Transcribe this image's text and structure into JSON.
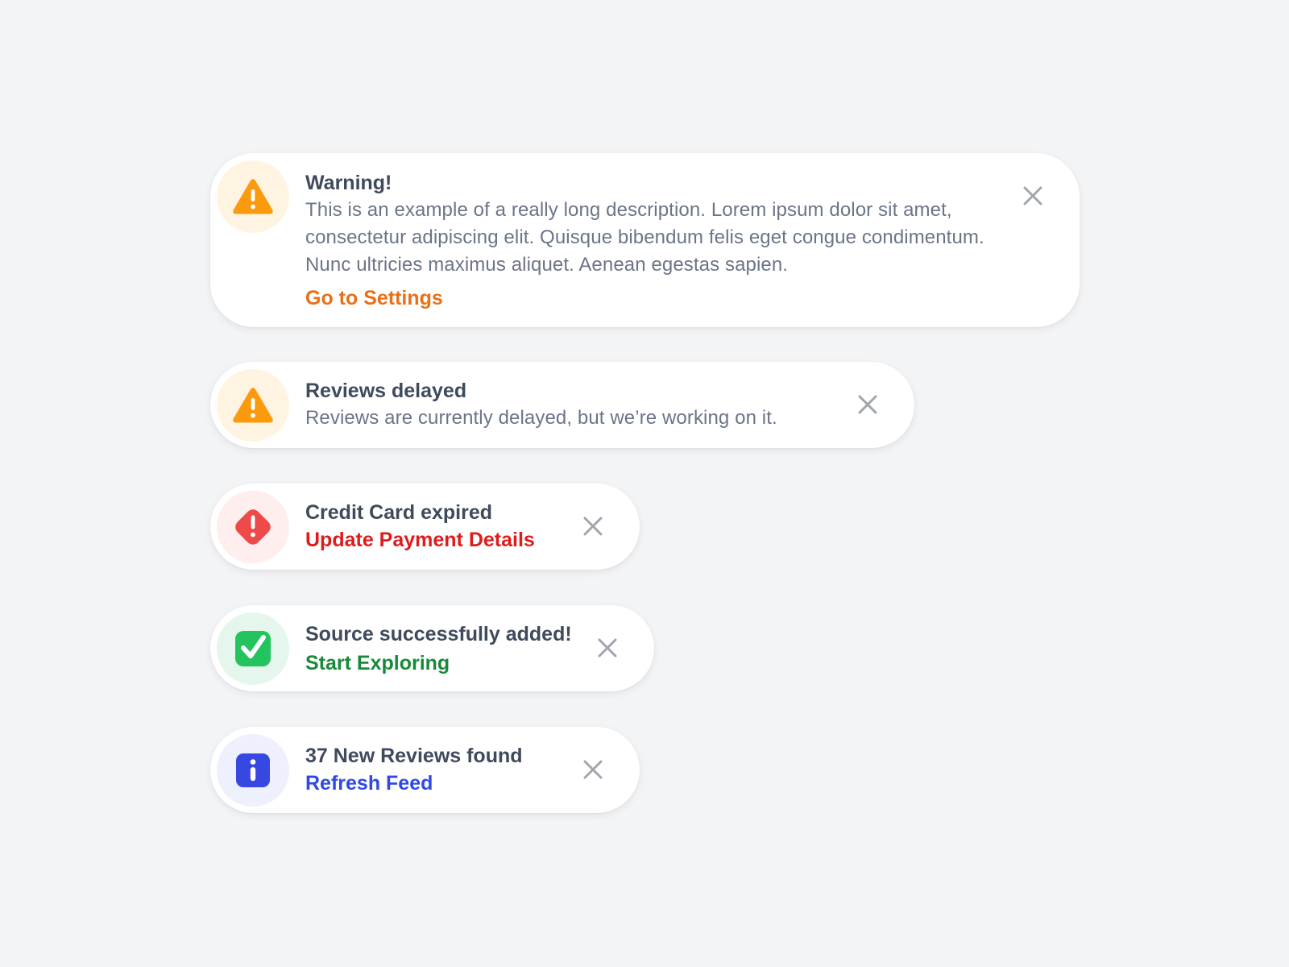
{
  "notifications": [
    {
      "kind": "warning",
      "title": "Warning!",
      "description": "This is an example of a really long description. Lorem ipsum dolor sit amet, consectetur adipiscing elit. Quisque bibendum felis eget congue condimentum. Nunc ultricies maximus aliquet. Aenean egestas sapien.",
      "action": "Go to Settings",
      "icon": "warning-triangle-icon",
      "action_color": "#ea7018",
      "icon_color": "#fb9a0c",
      "icon_bg": "#fff4e2"
    },
    {
      "kind": "warning",
      "title": "Reviews delayed",
      "description": "Reviews are currently delayed, but we’re working on it.",
      "icon": "warning-triangle-icon",
      "icon_color": "#fb9a0c",
      "icon_bg": "#fff4e2"
    },
    {
      "kind": "error",
      "title": "Credit Card expired",
      "action": "Update Payment Details",
      "icon": "error-diamond-icon",
      "action_color": "#de1c1c",
      "icon_color": "#ee4a4a",
      "icon_bg": "#feeeee"
    },
    {
      "kind": "success",
      "title": "Source successfully added!",
      "action": "Start Exploring",
      "icon": "success-check-icon",
      "action_color": "#198a3a",
      "icon_color": "#23c45d",
      "icon_bg": "#e5f7ec"
    },
    {
      "kind": "info",
      "title": "37 New Reviews found",
      "action": "Refresh Feed",
      "icon": "info-icon",
      "action_color": "#3049e3",
      "icon_color": "#3748e2",
      "icon_bg": "#eff0fe"
    }
  ],
  "close_icon": "close-icon",
  "close_color": "#a1a5ad"
}
